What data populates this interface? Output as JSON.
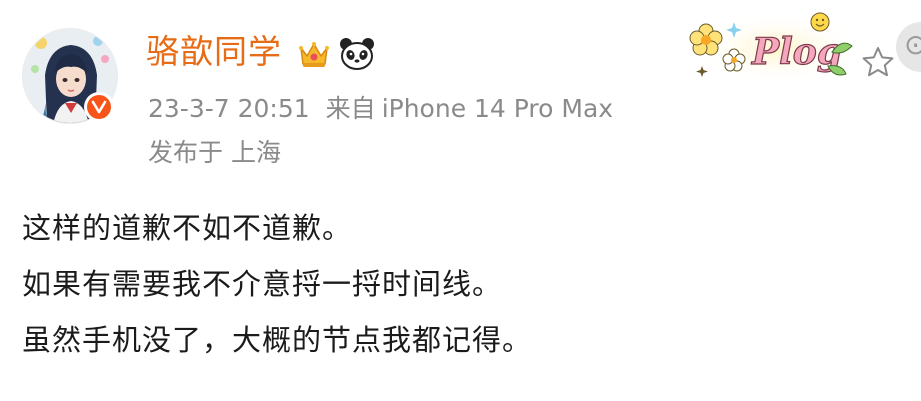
{
  "post": {
    "author": {
      "name": "骆歆同学",
      "verified": true,
      "badges": [
        "crown-icon",
        "panda-icon"
      ]
    },
    "meta": {
      "datetime": "23-3-7 20:51",
      "source_label": "来自",
      "device": "iPhone 14 Pro Max",
      "location_label": "发布于",
      "location": "上海"
    },
    "decoration": {
      "sticker_text": "Plog"
    },
    "body_lines": [
      "这样的道歉不如不道歉。",
      "如果有需要我不介意捋一捋时间线。",
      "虽然手机没了，大概的节点我都记得。"
    ]
  },
  "colors": {
    "username": "#e86b16",
    "meta_gray": "#8a8a8a",
    "verified_orange": "#f7541a",
    "body_text": "#1b1b1b"
  }
}
